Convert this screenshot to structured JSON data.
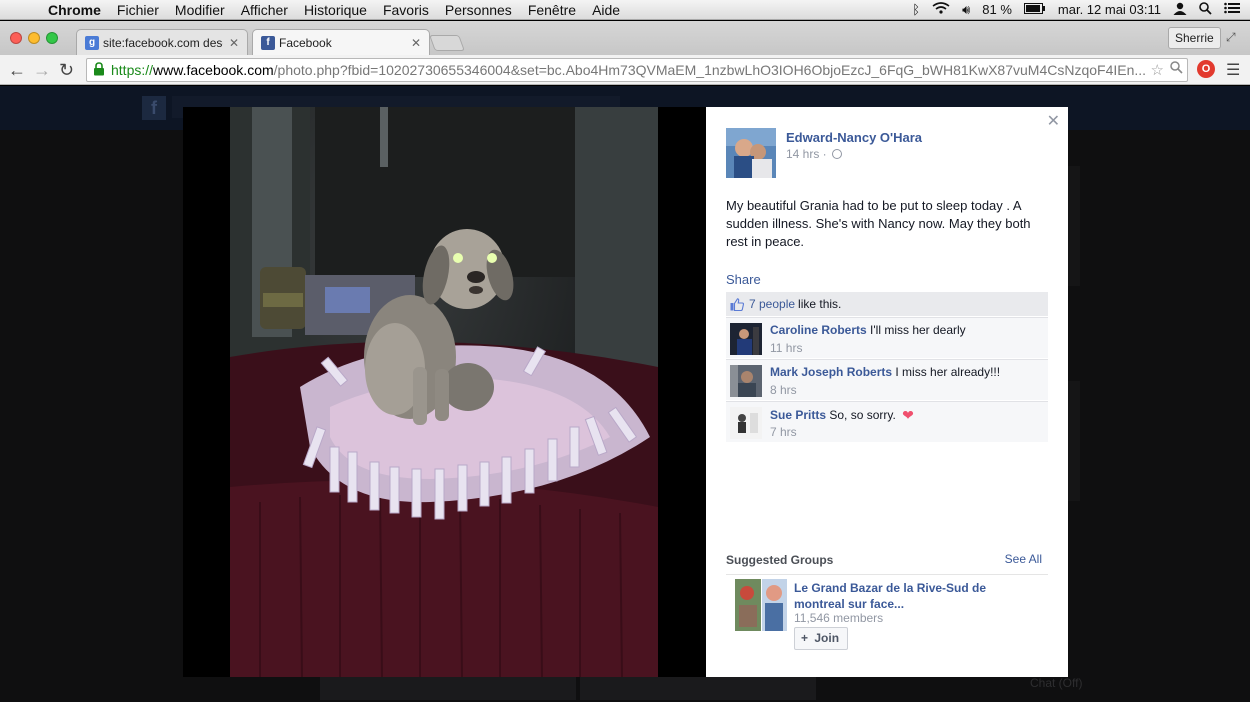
{
  "menubar": {
    "app": "Chrome",
    "items": [
      "Fichier",
      "Modifier",
      "Afficher",
      "Historique",
      "Favoris",
      "Personnes",
      "Fenêtre",
      "Aide"
    ],
    "battery": "81 %",
    "datetime": "mar. 12 mai  03:11",
    "icons": [
      "apple-icon",
      "bluetooth-icon",
      "wifi-icon",
      "volume-icon",
      "battery-icon",
      "user-icon",
      "spotlight-icon",
      "list-icon"
    ]
  },
  "tabs": [
    {
      "title": "site:facebook.com descanso",
      "favicon": "google-icon",
      "active": false
    },
    {
      "title": "Facebook",
      "favicon": "facebook-icon",
      "active": true
    }
  ],
  "profile": "Sherrie",
  "url": {
    "scheme": "https://",
    "host": "www.facebook.com",
    "path": "/photo.php?fbid=10202730655346004&set=bc.Abo4Hm73QVMaEM_1nzbwLhO3IOH6ObjoEzcJ_6FqG_bWH81KwX87vuM4CsNzqoF4IEn..."
  },
  "background": {
    "chat_label": "Chat (Off)"
  },
  "post": {
    "author": "Edward-Nancy O'Hara",
    "time": "14 hrs ·",
    "caption": "My beautiful Grania had to be put to sleep today . A sudden illness. She's with Nancy now. May they both rest in peace.",
    "share": "Share",
    "likes_count": "7 people",
    "likes_suffix": "like this."
  },
  "comments": [
    {
      "name": "Caroline Roberts",
      "text": "I'll miss her dearly",
      "time": "11 hrs"
    },
    {
      "name": "Mark Joseph Roberts",
      "text": "I miss her already!!!",
      "time": "8 hrs"
    },
    {
      "name": "Sue Pritts",
      "text": "So, so sorry.",
      "time": "7 hrs"
    }
  ],
  "suggested": {
    "title": "Suggested Groups",
    "see_all": "See All",
    "group_name": "Le Grand Bazar de la Rive-Sud de montreal sur face...",
    "members": "11,546 members",
    "join": "Join"
  },
  "colors": {
    "facebook_blue": "#3b5998",
    "muted_text": "#9197a3",
    "like_bar": "#e9eaed",
    "omnibox_green": "#1a8a1a"
  }
}
